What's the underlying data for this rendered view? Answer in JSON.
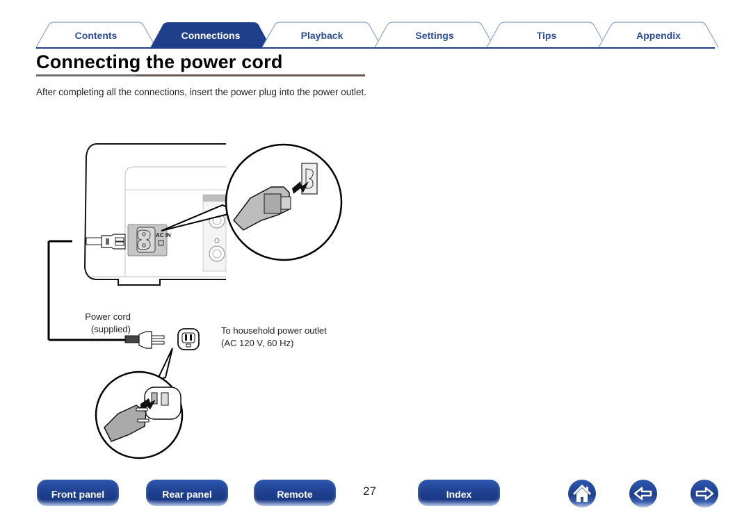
{
  "tabs": [
    {
      "label": "Contents",
      "active": false
    },
    {
      "label": "Connections",
      "active": true
    },
    {
      "label": "Playback",
      "active": false
    },
    {
      "label": "Settings",
      "active": false
    },
    {
      "label": "Tips",
      "active": false
    },
    {
      "label": "Appendix",
      "active": false
    }
  ],
  "page": {
    "title": "Connecting the power cord",
    "intro": "After completing all the connections, insert the power plug into the power outlet."
  },
  "diagram": {
    "ac_in_label": "AC IN",
    "power_cord_label": "Power cord",
    "power_cord_sub": "(supplied)",
    "outlet_label": "To household power outlet",
    "outlet_spec": "(AC 120 V, 60 Hz)"
  },
  "footer": {
    "buttons": [
      "Front panel",
      "Rear panel",
      "Remote",
      "Index"
    ],
    "page_number": "27",
    "icons": [
      "home-icon",
      "arrow-left-icon",
      "arrow-right-icon"
    ]
  },
  "colors": {
    "brand_blue": "#1f3f8a",
    "tab_text": "#2b4d9a"
  }
}
